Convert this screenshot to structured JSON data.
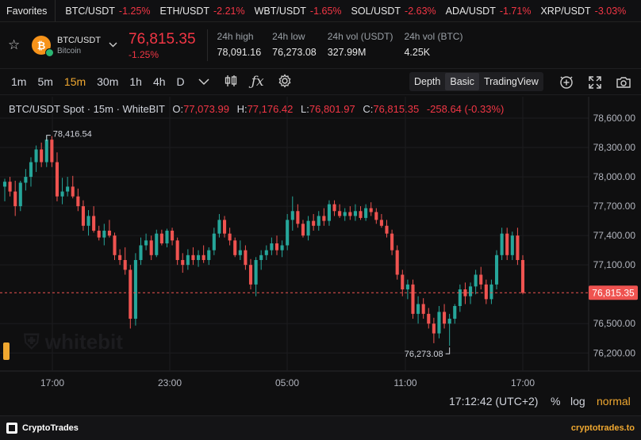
{
  "ticker": {
    "favorites_label": "Favorites",
    "items": [
      {
        "symbol": "BTC/USDT",
        "change": "-1.25%"
      },
      {
        "symbol": "ETH/USDT",
        "change": "-2.21%"
      },
      {
        "symbol": "WBT/USDT",
        "change": "-1.65%"
      },
      {
        "symbol": "SOL/USDT",
        "change": "-2.63%"
      },
      {
        "symbol": "ADA/USDT",
        "change": "-1.71%"
      },
      {
        "symbol": "XRP/USDT",
        "change": "-3.03%"
      }
    ]
  },
  "header": {
    "pair": "BTC/USDT",
    "name": "Bitcoin",
    "coin_symbol": "₿",
    "price": "76,815.35",
    "change": "-1.25%",
    "stats": [
      {
        "label": "24h high",
        "value": "78,091.16"
      },
      {
        "label": "24h low",
        "value": "76,273.08"
      },
      {
        "label": "24h vol (USDT)",
        "value": "327.99M"
      },
      {
        "label": "24h vol (BTC)",
        "value": "4.25K"
      }
    ]
  },
  "toolbar": {
    "timeframes": [
      "1m",
      "5m",
      "15m",
      "30m",
      "1h",
      "4h",
      "D"
    ],
    "active_timeframe": "15m",
    "views": [
      "Depth",
      "Basic",
      "TradingView"
    ],
    "active_view": "Basic"
  },
  "legend": {
    "title": "BTC/USDT Spot · 15m · WhiteBIT",
    "o_label": "O:",
    "o": "77,073.99",
    "h_label": "H:",
    "h": "77,176.42",
    "l_label": "L:",
    "l": "76,801.97",
    "c_label": "C:",
    "c": "76,815.35",
    "change": "-258.64 (-0.33%)"
  },
  "chart_data": {
    "type": "candlestick",
    "y_ticks": [
      "78,600.00",
      "78,300.00",
      "78,000.00",
      "77,700.00",
      "77,400.00",
      "77,100.00",
      "76,500.00",
      "76,200.00"
    ],
    "ylim": [
      76100,
      78750
    ],
    "x_ticks": [
      "17:00",
      "23:00",
      "05:00",
      "11:00",
      "17:00"
    ],
    "last_price_label": "76,815.35",
    "last_price": 76815.35,
    "high_marker": "78,416.54",
    "high_value": 78416.54,
    "low_marker": "76,273.08",
    "low_value": 76273.08,
    "up_color": "#26a69a",
    "down_color": "#ef5350",
    "candles": [
      [
        77900,
        77980,
        77750,
        77950
      ],
      [
        77950,
        78000,
        77800,
        77850
      ],
      [
        77850,
        77960,
        77600,
        77700
      ],
      [
        77700,
        77960,
        77650,
        77940
      ],
      [
        77940,
        78080,
        77860,
        78000
      ],
      [
        78000,
        78200,
        77900,
        78150
      ],
      [
        78150,
        78320,
        78050,
        78280
      ],
      [
        78280,
        78350,
        78100,
        78150
      ],
      [
        78150,
        78420,
        78100,
        78380
      ],
      [
        78380,
        78416,
        78100,
        78150
      ],
      [
        78150,
        78250,
        77750,
        77800
      ],
      [
        77800,
        77990,
        77720,
        77850
      ],
      [
        77850,
        78000,
        77800,
        77900
      ],
      [
        77900,
        78010,
        77780,
        77800
      ],
      [
        77800,
        77880,
        77650,
        77700
      ],
      [
        77700,
        77760,
        77450,
        77500
      ],
      [
        77500,
        77660,
        77400,
        77600
      ],
      [
        77600,
        77700,
        77430,
        77450
      ],
      [
        77450,
        77500,
        77350,
        77380
      ],
      [
        77380,
        77520,
        77300,
        77450
      ],
      [
        77450,
        77560,
        77380,
        77400
      ],
      [
        77400,
        77430,
        77150,
        77200
      ],
      [
        77200,
        77260,
        77100,
        77150
      ],
      [
        77150,
        77280,
        77000,
        77050
      ],
      [
        77050,
        77100,
        76450,
        76550
      ],
      [
        76550,
        77220,
        76480,
        77150
      ],
      [
        77150,
        77380,
        77100,
        77300
      ],
      [
        77300,
        77420,
        77250,
        77350
      ],
      [
        77350,
        77400,
        77150,
        77200
      ],
      [
        77200,
        77460,
        77180,
        77420
      ],
      [
        77420,
        77460,
        77300,
        77320
      ],
      [
        77320,
        77470,
        77280,
        77450
      ],
      [
        77450,
        77480,
        77300,
        77350
      ],
      [
        77350,
        77380,
        77100,
        77150
      ],
      [
        77150,
        77220,
        77020,
        77100
      ],
      [
        77100,
        77260,
        77050,
        77200
      ],
      [
        77200,
        77280,
        77100,
        77150
      ],
      [
        77150,
        77250,
        77080,
        77200
      ],
      [
        77200,
        77300,
        77120,
        77150
      ],
      [
        77150,
        77280,
        77100,
        77250
      ],
      [
        77250,
        77480,
        77200,
        77420
      ],
      [
        77420,
        77620,
        77380,
        77560
      ],
      [
        77560,
        77600,
        77380,
        77420
      ],
      [
        77420,
        77480,
        77300,
        77350
      ],
      [
        77350,
        77380,
        77180,
        77200
      ],
      [
        77200,
        77350,
        77150,
        77250
      ],
      [
        77250,
        77300,
        77050,
        77100
      ],
      [
        77100,
        77160,
        76850,
        76900
      ],
      [
        76900,
        77180,
        76780,
        77150
      ],
      [
        77150,
        77250,
        77050,
        77200
      ],
      [
        77200,
        77300,
        77150,
        77250
      ],
      [
        77250,
        77380,
        77200,
        77320
      ],
      [
        77320,
        77400,
        77200,
        77250
      ],
      [
        77250,
        77350,
        77180,
        77300
      ],
      [
        77300,
        77620,
        77250,
        77560
      ],
      [
        77560,
        77800,
        77450,
        77650
      ],
      [
        77650,
        77720,
        77480,
        77520
      ],
      [
        77520,
        77560,
        77380,
        77400
      ],
      [
        77400,
        77600,
        77350,
        77550
      ],
      [
        77550,
        77620,
        77450,
        77500
      ],
      [
        77500,
        77650,
        77450,
        77600
      ],
      [
        77600,
        77680,
        77500,
        77550
      ],
      [
        77550,
        77760,
        77500,
        77720
      ],
      [
        77720,
        77760,
        77600,
        77650
      ],
      [
        77650,
        77720,
        77580,
        77600
      ],
      [
        77600,
        77680,
        77550,
        77640
      ],
      [
        77640,
        77700,
        77560,
        77600
      ],
      [
        77600,
        77720,
        77550,
        77650
      ],
      [
        77650,
        77700,
        77560,
        77580
      ],
      [
        77580,
        77720,
        77550,
        77680
      ],
      [
        77680,
        77740,
        77600,
        77640
      ],
      [
        77640,
        77680,
        77520,
        77560
      ],
      [
        77560,
        77620,
        77480,
        77500
      ],
      [
        77500,
        77560,
        77380,
        77420
      ],
      [
        77420,
        77460,
        77200,
        77250
      ],
      [
        77250,
        77300,
        76950,
        77000
      ],
      [
        77000,
        77050,
        76780,
        76850
      ],
      [
        76850,
        76950,
        76750,
        76900
      ],
      [
        76900,
        76950,
        76550,
        76600
      ],
      [
        76600,
        76780,
        76500,
        76700
      ],
      [
        76700,
        76760,
        76550,
        76600
      ],
      [
        76600,
        76660,
        76450,
        76500
      ],
      [
        76500,
        76560,
        76300,
        76400
      ],
      [
        76400,
        76680,
        76350,
        76620
      ],
      [
        76620,
        76700,
        76450,
        76500
      ],
      [
        76500,
        76600,
        76273,
        76550
      ],
      [
        76550,
        76700,
        76500,
        76680
      ],
      [
        76680,
        76900,
        76620,
        76850
      ],
      [
        76850,
        76920,
        76700,
        76780
      ],
      [
        76780,
        76920,
        76700,
        76880
      ],
      [
        76880,
        77050,
        76800,
        77000
      ],
      [
        77000,
        77080,
        76850,
        76900
      ],
      [
        76900,
        76950,
        76700,
        76750
      ],
      [
        76750,
        76950,
        76700,
        76900
      ],
      [
        76900,
        77250,
        76850,
        77200
      ],
      [
        77200,
        77480,
        77150,
        77420
      ],
      [
        77420,
        77480,
        77150,
        77200
      ],
      [
        77200,
        77440,
        77150,
        77400
      ],
      [
        77400,
        77480,
        77100,
        77150
      ],
      [
        77150,
        77200,
        76800,
        76815
      ]
    ]
  }
}
